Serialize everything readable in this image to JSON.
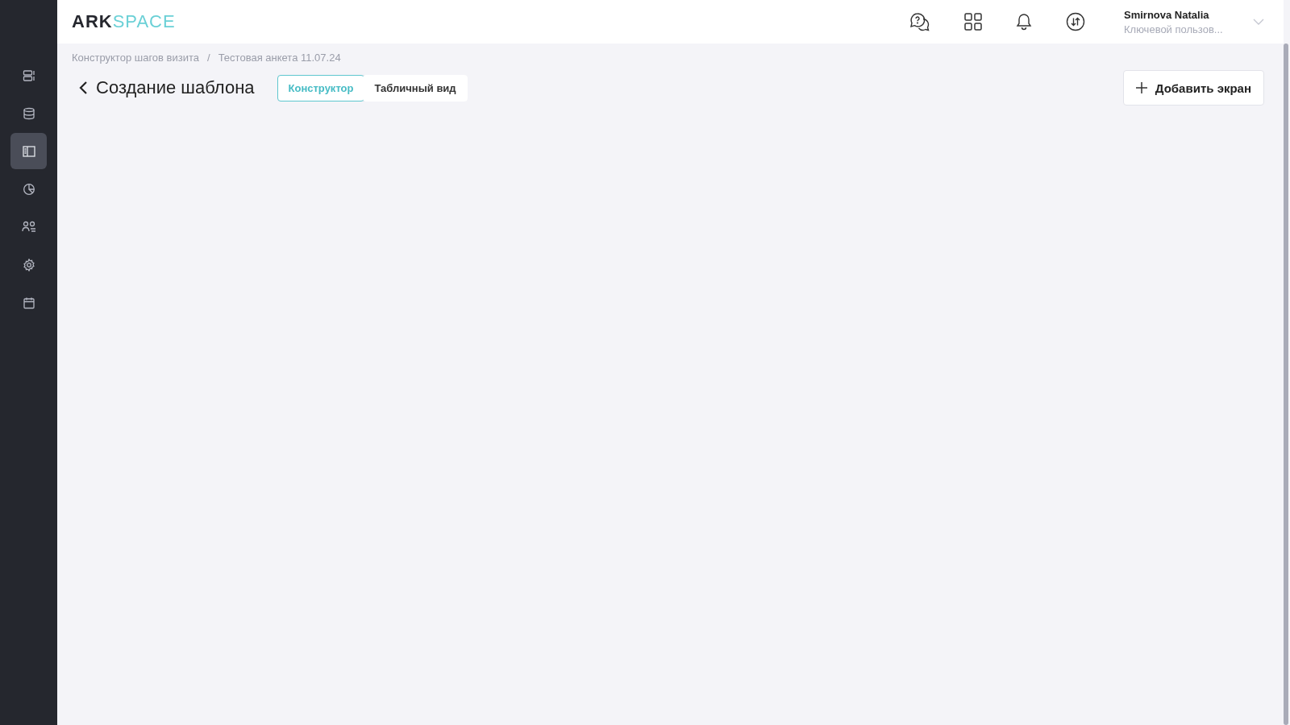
{
  "sidebar": {
    "items": [
      {
        "kind": "panels",
        "selected": false
      },
      {
        "kind": "database",
        "selected": false
      },
      {
        "kind": "layout",
        "selected": true
      },
      {
        "kind": "chart",
        "selected": false
      },
      {
        "kind": "users",
        "selected": false
      },
      {
        "kind": "settings",
        "selected": false
      },
      {
        "kind": "calendar",
        "selected": false
      }
    ]
  },
  "header": {
    "logo": {
      "part_1": "ARK",
      "part_2": "SPACE"
    },
    "icons": [
      {
        "kind": "help"
      },
      {
        "kind": "apps"
      },
      {
        "kind": "notifications"
      },
      {
        "kind": "sync"
      }
    ],
    "user": {
      "name": "Smirnova Natalia",
      "role": "Ключевой пользов..."
    }
  },
  "breadcrumbs": [
    "Конструктор шагов визита",
    "Тестовая анкета 11.07.24"
  ],
  "breadcrumb_separator": "/",
  "page": {
    "title": "Создание шаблона",
    "tabs": [
      {
        "label": "Конструктор",
        "selected": true
      },
      {
        "label": "Табличный вид",
        "selected": false
      }
    ],
    "add_button": "Добавить экран"
  }
}
